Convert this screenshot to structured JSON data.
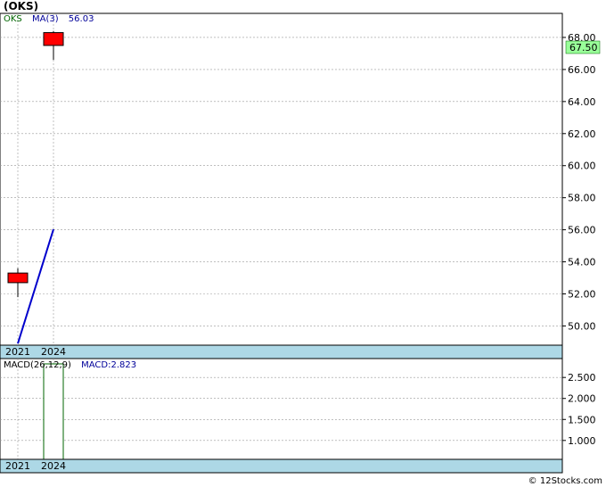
{
  "header": {
    "title": "(OKS)",
    "credit": "© 12Stocks.com"
  },
  "colors": {
    "candle": "#ff0000",
    "ma_line": "#0000cc",
    "macd_bar": "#006600",
    "ticker_text": "#006600",
    "legend_text": "#000099",
    "price_tag_bg": "#99ff99",
    "axis_band": "#add8e6",
    "grid": "#999999"
  },
  "chart_data": [
    {
      "type": "candlestick",
      "categories": [
        "2021",
        "2024"
      ],
      "series": [
        {
          "name": "OKS",
          "ohlc": [
            {
              "x": "2021",
              "open": 52.7,
              "high": 53.6,
              "low": 51.8,
              "close": 53.3
            },
            {
              "x": "2024",
              "open": 67.5,
              "high": 68.4,
              "low": 66.6,
              "close": 68.3
            }
          ]
        },
        {
          "name": "MA(3)",
          "type": "line",
          "values": [
            48.9,
            56.03
          ]
        }
      ],
      "legend": {
        "ticker": "OKS",
        "ma_label": "MA(3)",
        "ma_value": "56.03",
        "placement": "top-left"
      },
      "last_price": "67.50",
      "ylim": [
        48.8,
        69.5
      ],
      "yticks": [
        "50.00",
        "52.00",
        "54.00",
        "56.00",
        "58.00",
        "60.00",
        "62.00",
        "64.00",
        "66.00",
        "68.00"
      ],
      "grid": true
    },
    {
      "type": "bar",
      "categories": [
        "2021",
        "2024"
      ],
      "series": [
        {
          "name": "MACD(26,12,9)",
          "values": [
            null,
            2.823
          ]
        }
      ],
      "legend": {
        "label": "MACD(26,12,9)",
        "value_label": "MACD:2.823",
        "placement": "top-left"
      },
      "ylim": [
        0.55,
        2.95
      ],
      "yticks": [
        "1.000",
        "1.500",
        "2.000",
        "2.500"
      ],
      "grid": true
    }
  ]
}
